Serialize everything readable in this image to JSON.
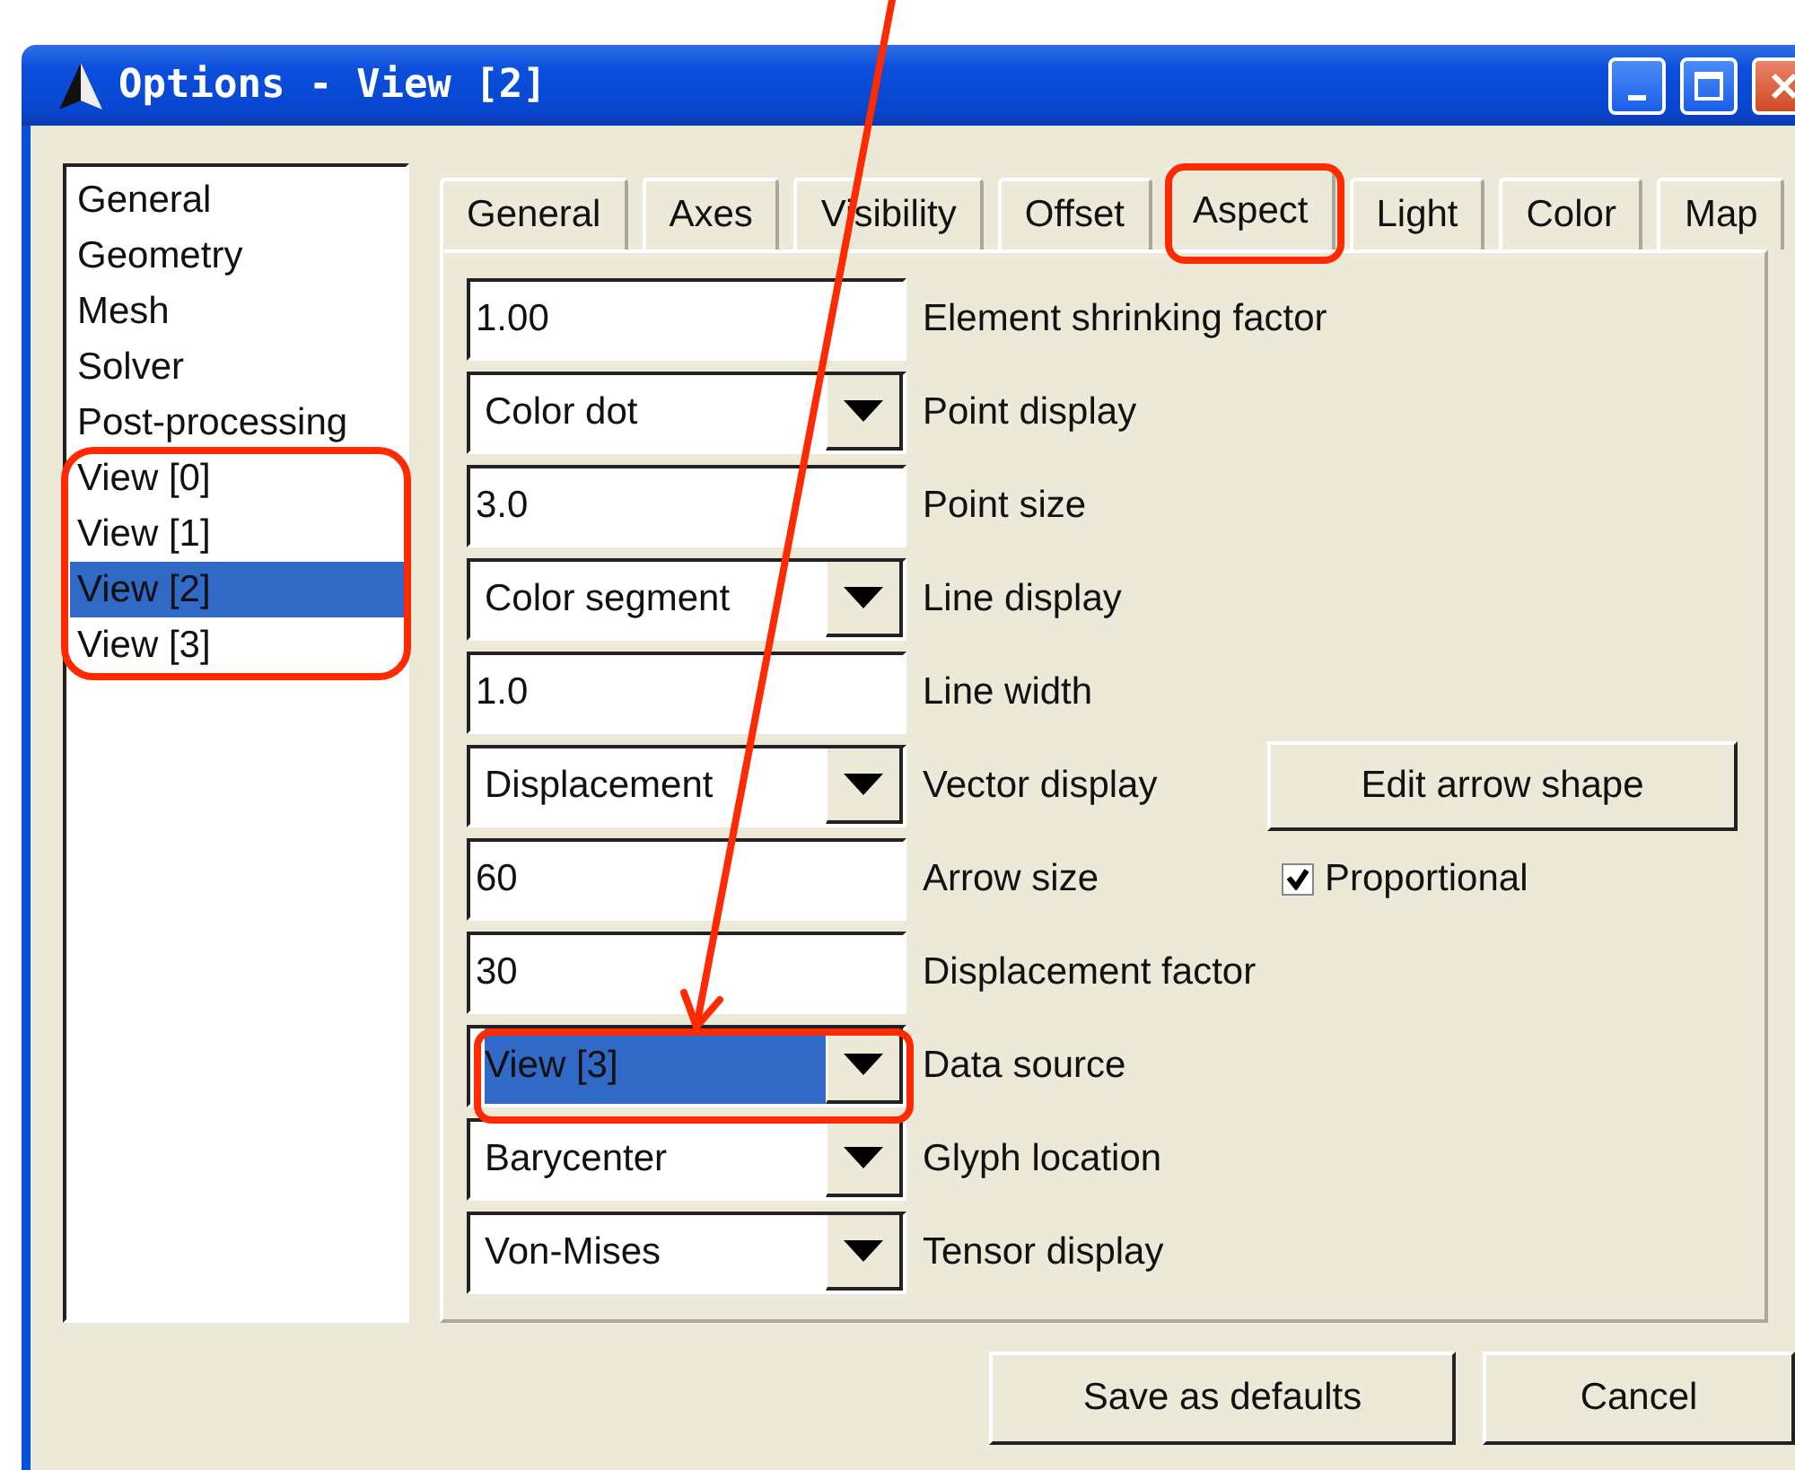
{
  "window": {
    "title": "Options - View [2]"
  },
  "categories": [
    {
      "label": "General",
      "selected": false
    },
    {
      "label": "Geometry",
      "selected": false
    },
    {
      "label": "Mesh",
      "selected": false
    },
    {
      "label": "Solver",
      "selected": false
    },
    {
      "label": "Post-processing",
      "selected": false
    },
    {
      "label": "View [0]",
      "selected": false
    },
    {
      "label": "View [1]",
      "selected": false
    },
    {
      "label": "View [2]",
      "selected": true
    },
    {
      "label": "View [3]",
      "selected": false
    }
  ],
  "tabs": [
    {
      "label": "General",
      "selected": false
    },
    {
      "label": "Axes",
      "selected": false
    },
    {
      "label": "Visibility",
      "selected": false
    },
    {
      "label": "Offset",
      "selected": false
    },
    {
      "label": "Aspect",
      "selected": true
    },
    {
      "label": "Light",
      "selected": false
    },
    {
      "label": "Color",
      "selected": false
    },
    {
      "label": "Map",
      "selected": false
    }
  ],
  "rows": [
    {
      "kind": "text",
      "value": "1.00",
      "label": "Element shrinking factor"
    },
    {
      "kind": "combo",
      "value": "Color dot",
      "label": "Point display",
      "highlighted": false
    },
    {
      "kind": "text",
      "value": "3.0",
      "label": "Point size"
    },
    {
      "kind": "combo",
      "value": "Color segment",
      "label": "Line display",
      "highlighted": false
    },
    {
      "kind": "text",
      "value": "1.0",
      "label": "Line width"
    },
    {
      "kind": "combo",
      "value": "Displacement",
      "label": "Vector display",
      "highlighted": false,
      "extra": {
        "kind": "button",
        "label": "Edit arrow shape"
      }
    },
    {
      "kind": "text",
      "value": "60",
      "label": "Arrow size",
      "extra": {
        "kind": "checkbox",
        "label": "Proportional",
        "checked": true
      }
    },
    {
      "kind": "text",
      "value": "30",
      "label": "Displacement factor"
    },
    {
      "kind": "combo",
      "value": "View [3]",
      "label": "Data source",
      "highlighted": true
    },
    {
      "kind": "combo",
      "value": "Barycenter",
      "label": "Glyph location",
      "highlighted": false
    },
    {
      "kind": "combo",
      "value": "Von-Mises",
      "label": "Tensor display",
      "highlighted": false
    }
  ],
  "buttons": [
    "Save as defaults",
    "Cancel"
  ]
}
